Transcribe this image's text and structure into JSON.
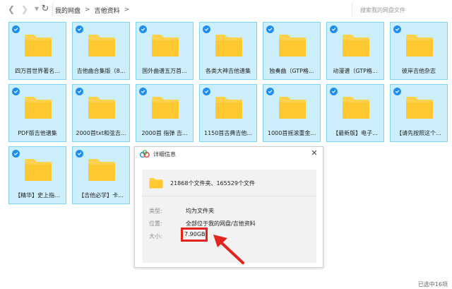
{
  "toolbar": {
    "back_icon": "chevron-left-icon",
    "forward_icon": "chevron-right-icon",
    "refresh_icon": "refresh-icon",
    "breadcrumb": [
      "我的网盘",
      "吉他资料"
    ],
    "search_placeholder": "搜索我的网盘文件"
  },
  "folders": [
    {
      "label": "四万首世界著名..."
    },
    {
      "label": "吉他曲合集版（8..."
    },
    {
      "label": "国外曲谱五万首..."
    },
    {
      "label": "各类大神吉他谱集"
    },
    {
      "label": "独奏曲（GTP格..."
    },
    {
      "label": "动漫谱（GTP格..."
    },
    {
      "label": "彼岸吉他杂志"
    },
    {
      "label": "PDF版吉他谱集"
    },
    {
      "label": "2000首txt和弦吉..."
    },
    {
      "label": "2000首 指弹 吉..."
    },
    {
      "label": "1150首古典吉他..."
    },
    {
      "label": "1000首摇滚重金..."
    },
    {
      "label": "【最新版】电子..."
    },
    {
      "label": "【请先按照这个..."
    },
    {
      "label": "【精华】史上指..."
    },
    {
      "label": "【吉他必学】卡..."
    }
  ],
  "dialog": {
    "title": "详细信息",
    "close_label": "✕",
    "count_text": "21868个文件夹、165529个文件",
    "type_label": "类型:",
    "type_value": "均为文件夹",
    "location_label": "位置:",
    "location_value": "全部位于我的网盘/吉他资料",
    "size_label": "大小:",
    "size_value": "7.90GB"
  },
  "status": {
    "text": "已选中16项"
  },
  "colors": {
    "tile_bg": "#cdeffb",
    "tile_border": "#7fd4f1",
    "check": "#1e8ef0",
    "folder": "#ffd04b",
    "highlight": "#e3231d"
  }
}
